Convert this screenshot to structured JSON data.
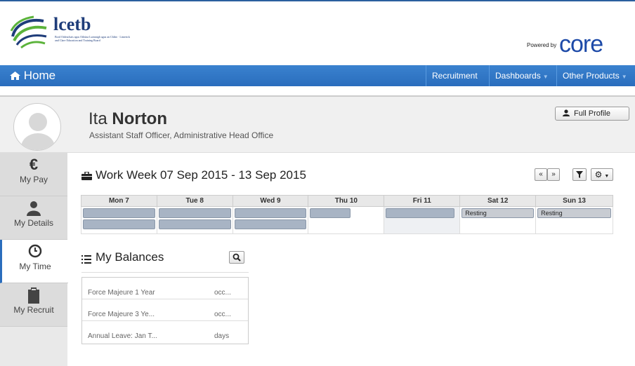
{
  "brand": {
    "logo_text": "lcetb",
    "logo_subtext": "Bord Oideachais agus Oiliúna Luimnigh agus an Chláir · Limerick and Clare Education and Training Board",
    "powered_by": "Powered by",
    "core_text": "cor",
    "core_last_letter": "e"
  },
  "nav": {
    "home_label": "Home",
    "items": [
      {
        "label": "Recruitment",
        "dropdown": false
      },
      {
        "label": "Dashboards",
        "dropdown": true
      },
      {
        "label": "Other Products",
        "dropdown": true
      }
    ],
    "colors": {
      "bar": "#2a6dbd"
    }
  },
  "profile": {
    "first_name": "Ita",
    "last_name": "Norton",
    "role": "Assistant Staff Officer, Administrative Head Office",
    "full_profile_label": "Full Profile"
  },
  "sidebar": {
    "tabs": [
      {
        "label": "My Pay",
        "icon": "euro-icon",
        "glyph": "€",
        "active": false
      },
      {
        "label": "My Details",
        "icon": "user-icon",
        "active": false
      },
      {
        "label": "My Time",
        "icon": "clock-icon",
        "active": true
      },
      {
        "label": "My Recruit",
        "icon": "clipboard-icon",
        "active": false
      }
    ]
  },
  "work_week": {
    "title": "Work Week 07 Sep 2015 - 13 Sep 2015",
    "prev_label": "«",
    "next_label": "»",
    "days": [
      {
        "label": "Mon 7",
        "shifts": [
          "",
          ""
        ]
      },
      {
        "label": "Tue 8",
        "shifts": [
          "",
          ""
        ]
      },
      {
        "label": "Wed 9",
        "shifts": [
          "",
          ""
        ]
      },
      {
        "label": "Thu 10",
        "shifts": [
          ""
        ]
      },
      {
        "label": "Fri 11",
        "shifts": [
          ""
        ]
      },
      {
        "label": "Sat 12",
        "shifts": [
          "Resting"
        ]
      },
      {
        "label": "Sun 13",
        "shifts": [
          "Resting"
        ]
      }
    ]
  },
  "balances": {
    "title": "My Balances",
    "rows": [
      {
        "name": "Force Majeure 1 Year",
        "unit": "occ..."
      },
      {
        "name": "Force Majeure 3 Ye...",
        "unit": "occ..."
      },
      {
        "name": "Annual Leave: Jan T...",
        "unit": "days"
      }
    ]
  }
}
